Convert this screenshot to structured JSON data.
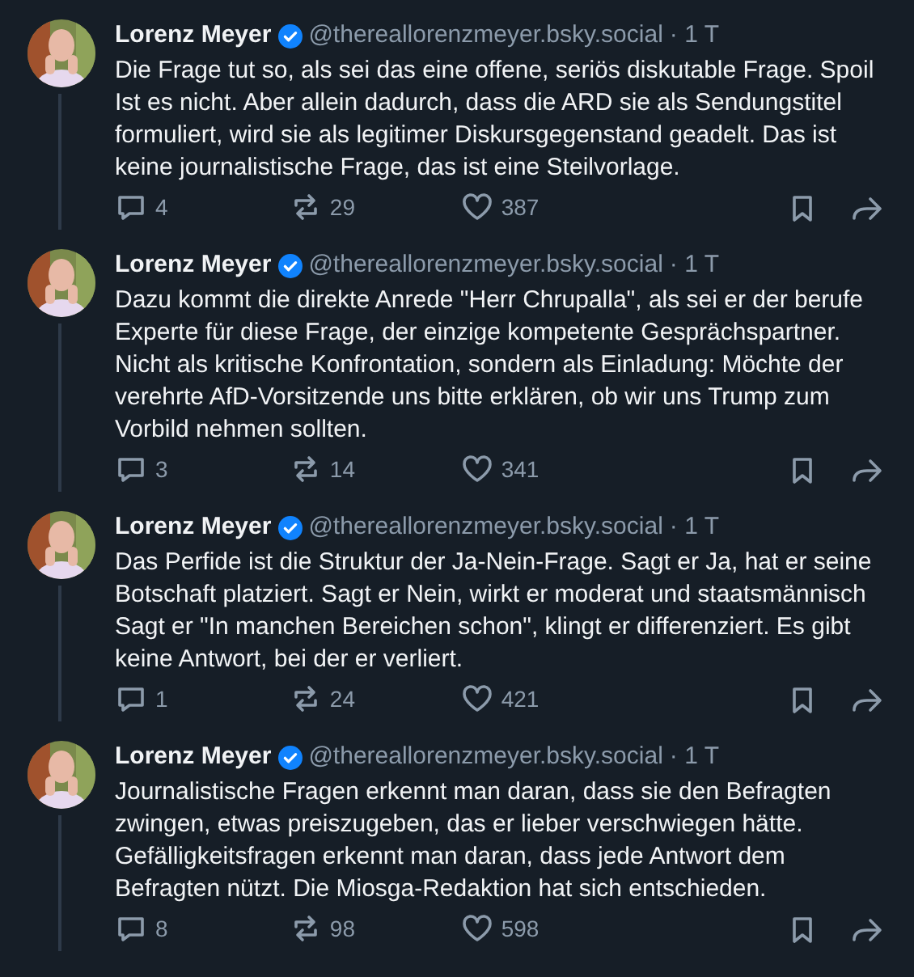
{
  "posts": [
    {
      "author": "Lorenz Meyer",
      "verified": true,
      "handle": "@thereallorenzmeyer.bsky.social",
      "time": "· 1 T",
      "lines": [
        "Die Frage tut so, als sei das eine offene, seriös diskutable Frage. Spoil",
        "Ist es nicht. Aber allein dadurch, dass die ARD sie als Sendungstitel",
        "formuliert, wird sie als legitimer Diskursgegenstand geadelt. Das ist",
        "keine journalistische Frage, das ist eine Steilvorlage."
      ],
      "replies": "4",
      "reposts": "29",
      "likes": "387"
    },
    {
      "author": "Lorenz Meyer",
      "verified": true,
      "handle": "@thereallorenzmeyer.bsky.social",
      "time": "· 1 T",
      "lines": [
        "Dazu kommt die direkte Anrede \"Herr Chrupalla\", als sei er der berufe",
        "Experte für diese Frage, der einzige kompetente Gesprächspartner.",
        "Nicht als kritische Konfrontation, sondern als Einladung: Möchte der",
        "verehrte AfD-Vorsitzende uns bitte erklären, ob wir uns Trump zum",
        "Vorbild nehmen sollten."
      ],
      "replies": "3",
      "reposts": "14",
      "likes": "341"
    },
    {
      "author": "Lorenz Meyer",
      "verified": true,
      "handle": "@thereallorenzmeyer.bsky.social",
      "time": "· 1 T",
      "lines": [
        "Das Perfide ist die Struktur der Ja-Nein-Frage. Sagt er Ja, hat er seine",
        "Botschaft platziert. Sagt er Nein, wirkt er moderat und staatsmännisch",
        "Sagt er \"In manchen Bereichen schon\", klingt er differenziert. Es gibt",
        "keine Antwort, bei der er verliert."
      ],
      "replies": "1",
      "reposts": "24",
      "likes": "421"
    },
    {
      "author": "Lorenz Meyer",
      "verified": true,
      "handle": "@thereallorenzmeyer.bsky.social",
      "time": "· 1 T",
      "lines": [
        "Journalistische Fragen erkennt man daran, dass sie den Befragten",
        "zwingen, etwas preiszugeben, das er lieber verschwiegen hätte.",
        "Gefälligkeitsfragen erkennt man daran, dass jede Antwort dem",
        "Befragten nützt. Die Miosga-Redaktion hat sich entschieden."
      ],
      "replies": "8",
      "reposts": "98",
      "likes": "598"
    }
  ]
}
